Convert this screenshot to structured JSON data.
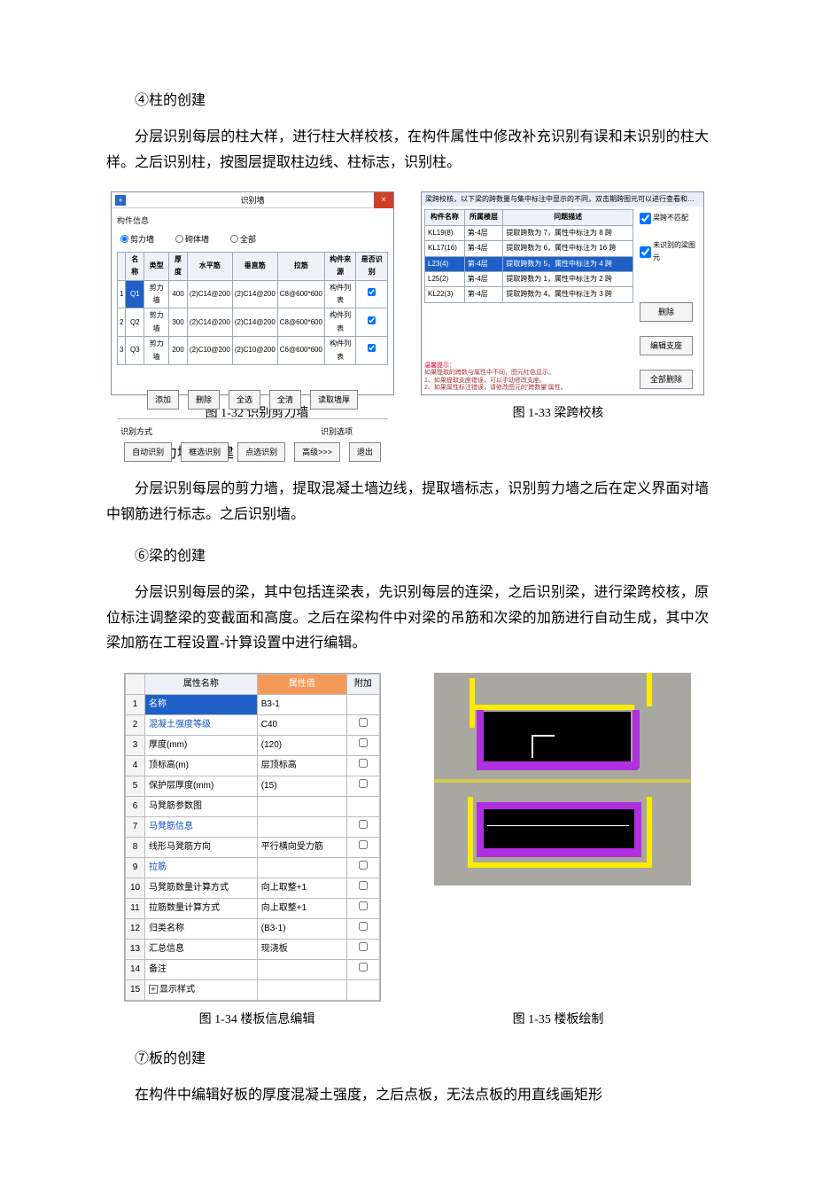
{
  "text": {
    "sec4_title": "④柱的创建",
    "p4": "分层识别每层的柱大样，进行柱大样校核，在构件属性中修改补充识别有误和未识别的柱大样。之后识别柱，按图层提取柱边线、柱标志，识别柱。",
    "cap32": "图 1-32 识别剪力墙",
    "cap33": "图 1-33  梁跨校核",
    "sec5_title": "⑤剪力墙的创建",
    "p5": "分层识别每层的剪力墙，提取混凝土墙边线，提取墙标志，识别剪力墙之后在定义界面对墙中钢筋进行标志。之后识别墙。",
    "sec6_title": "⑥梁的创建",
    "p6": "分层识别每层的梁，其中包括连梁表，先识别每层的连梁，之后识别梁，进行梁跨校核，原位标注调整梁的变截面和高度。之后在梁构件中对梁的吊筋和次梁的加筋进行自动生成，其中次梁加筋在工程设置-计算设置中进行编辑。",
    "cap34": "图 1-34  楼板信息编辑",
    "cap35": "图 1-35  楼板绘制",
    "sec7_title": "⑦板的创建",
    "p7": "在构件中编辑好板的厚度混凝土强度，之后点板，无法点板的用直线画矩形"
  },
  "fig32": {
    "title": "识别墙",
    "grp_label": "构件信息",
    "radio1": "剪力墙",
    "radio2": "砌体墙",
    "radio3": "全部",
    "headers": [
      "",
      "名称",
      "类型",
      "厚度",
      "水平筋",
      "垂直筋",
      "拉筋",
      "构件来源",
      "是否识别"
    ],
    "rows": [
      {
        "i": "1",
        "name": "Q1",
        "type": "剪力墙",
        "thk": "400",
        "h": "(2)C14@200",
        "v": "(2)C14@200",
        "t": "C8@600*600",
        "src": "构件列表",
        "chk": true,
        "sel": true
      },
      {
        "i": "2",
        "name": "Q2",
        "type": "剪力墙",
        "thk": "300",
        "h": "(2)C14@200",
        "v": "(2)C14@200",
        "t": "C8@600*600",
        "src": "构件列表",
        "chk": true
      },
      {
        "i": "3",
        "name": "Q3",
        "type": "剪力墙",
        "thk": "200",
        "h": "(2)C10@200",
        "v": "(2)C10@200",
        "t": "C6@600*600",
        "src": "构件列表",
        "chk": true
      }
    ],
    "btn_add": "添加",
    "btn_del": "删除",
    "btn_all": "全选",
    "btn_clr": "全清",
    "btn_read": "读取墙厚",
    "lbl_method": "识别方式",
    "lbl_opt": "识别选项",
    "btn_auto": "自动识别",
    "btn_frame": "框选识别",
    "btn_pick": "点选识别",
    "btn_adv": "高级>>>",
    "btn_exit": "退出"
  },
  "fig33": {
    "title": "梁跨校核，以下梁的跨数量与集中标注中显示的不同，双击期跨图元可以进行查看和…",
    "headers": [
      "构件名称",
      "所属楼层",
      "问题描述"
    ],
    "rows": [
      {
        "n": "KL19(8)",
        "f": "第-4层",
        "d": "提取跨数为 7，属性中标注为 8 跨"
      },
      {
        "n": "KL17(16)",
        "f": "第-4层",
        "d": "提取跨数为 6，属性中标注为 16 跨"
      },
      {
        "n": "L23(4)",
        "f": "第-4层",
        "d": "提取跨数为 5，属性中标注为 4 跨",
        "sel": true
      },
      {
        "n": "L25(2)",
        "f": "第-4层",
        "d": "提取跨数为 1，属性中标注为 2 跨"
      },
      {
        "n": "KL22(3)",
        "f": "第-4层",
        "d": "提取跨数为 4，属性中标注为 3 跨"
      }
    ],
    "chk1": "梁跨不匹配",
    "chk2": "未识别的梁图元",
    "btn_del": "删除",
    "btn_edit": "编辑支座",
    "btn_delall": "全部删除",
    "hint_t": "温馨提示：",
    "hint1": "如果提取的跨数与属性中不同，图元红色显示。",
    "hint2": "1、如果提取支座错误，可以手动修改支座。",
    "hint3": "2、如果属性标注错误，请修改图元的'跨数量'属性。"
  },
  "fig34": {
    "h1": "属性名称",
    "h2": "属性值",
    "h3": "附加",
    "rows": [
      {
        "i": "1",
        "n": "名称",
        "v": "B3-1",
        "link": true,
        "sel": true,
        "noChk": true
      },
      {
        "i": "2",
        "n": "混凝土强度等级",
        "v": "C40",
        "link": true
      },
      {
        "i": "3",
        "n": "厚度(mm)",
        "v": "(120)"
      },
      {
        "i": "4",
        "n": "顶标高(m)",
        "v": "层顶标高"
      },
      {
        "i": "5",
        "n": "保护层厚度(mm)",
        "v": "(15)"
      },
      {
        "i": "6",
        "n": "马凳筋参数图",
        "v": "",
        "noChk": true
      },
      {
        "i": "7",
        "n": "马凳筋信息",
        "v": "",
        "link": true
      },
      {
        "i": "8",
        "n": "线形马凳筋方向",
        "v": "平行横向受力筋"
      },
      {
        "i": "9",
        "n": "拉筋",
        "v": "",
        "link": true
      },
      {
        "i": "10",
        "n": "马凳筋数量计算方式",
        "v": "向上取整+1"
      },
      {
        "i": "11",
        "n": "拉筋数量计算方式",
        "v": "向上取整+1"
      },
      {
        "i": "12",
        "n": "归类名称",
        "v": "(B3-1)"
      },
      {
        "i": "13",
        "n": "汇总信息",
        "v": "现浇板"
      },
      {
        "i": "14",
        "n": "备注",
        "v": ""
      },
      {
        "i": "15",
        "n": "显示样式",
        "v": "",
        "plus": true,
        "noChk": true
      }
    ]
  }
}
